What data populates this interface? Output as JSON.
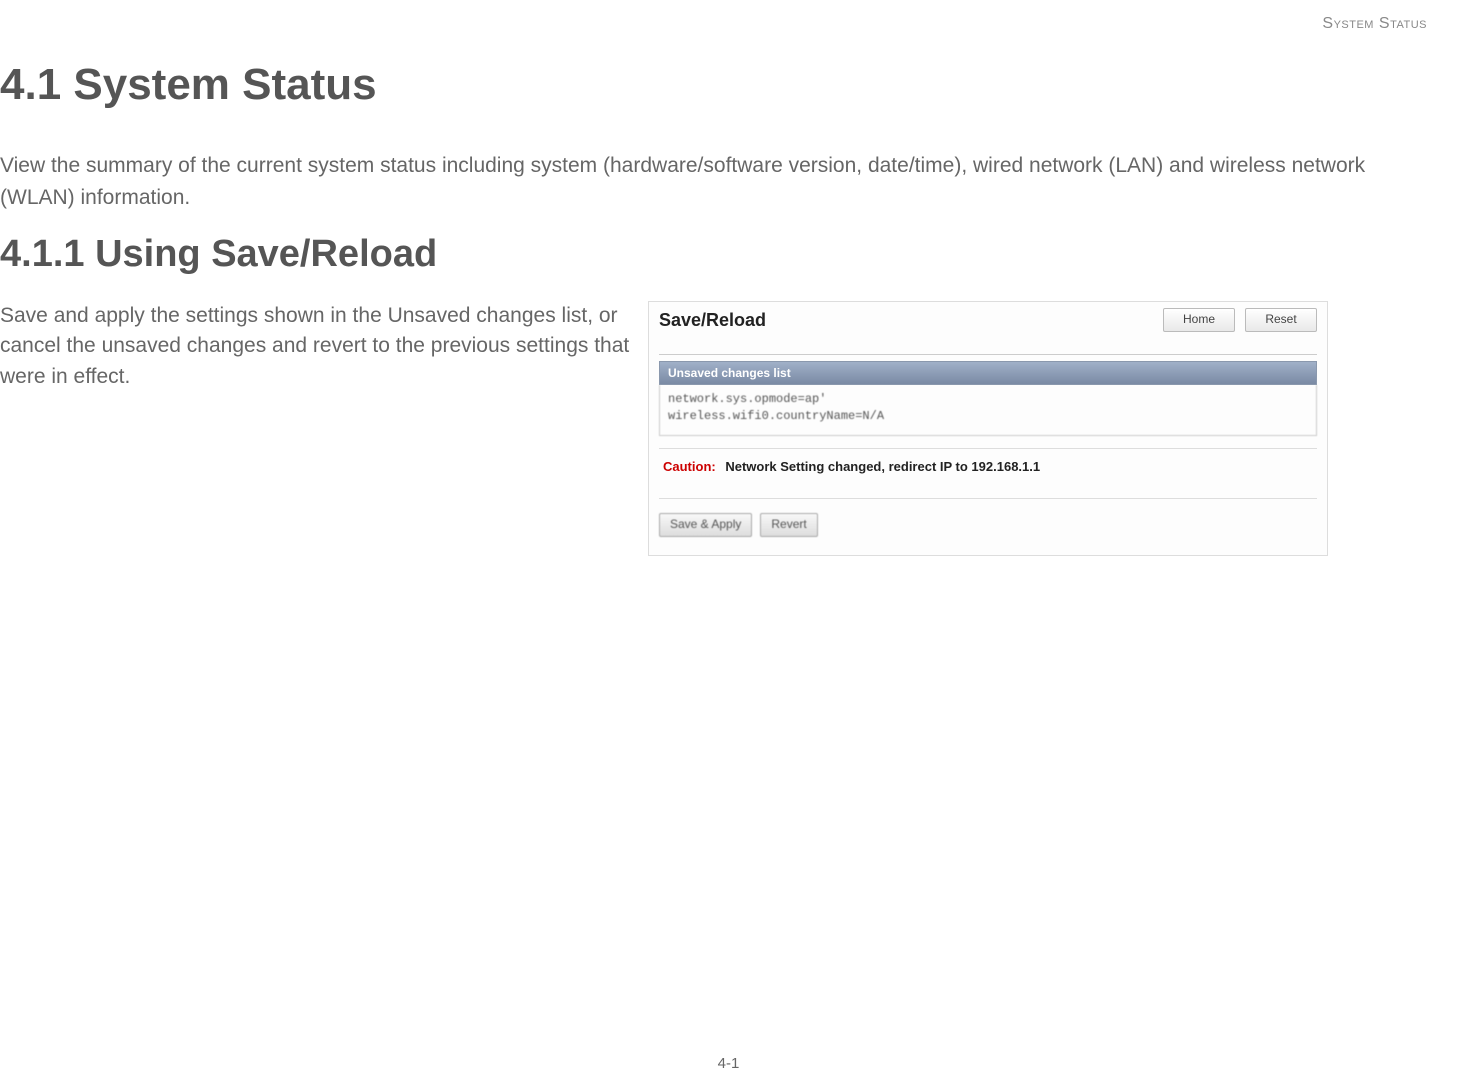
{
  "header": {
    "label": "System Status"
  },
  "section": {
    "heading": "4.1 System Status",
    "intro": "View the summary of the current system status including system (hardware/software version, date/time), wired network (LAN) and wireless network (WLAN) information."
  },
  "subsection": {
    "heading": "4.1.1 Using Save/Reload",
    "body": "Save and apply the settings shown in the Unsaved changes list, or cancel the unsaved changes and revert to the previous settings that were in effect."
  },
  "screenshot": {
    "title": "Save/Reload",
    "top_buttons": {
      "home": "Home",
      "reset": "Reset"
    },
    "panel_header": "Unsaved changes list",
    "panel_body": "network.sys.opmode=ap'\nwireless.wifi0.countryName=N/A",
    "caution_label": "Caution:",
    "caution_text": "Network Setting changed, redirect IP to 192.168.1.1",
    "actions": {
      "save_apply": "Save & Apply",
      "revert": "Revert"
    }
  },
  "footer": {
    "page": "4-1"
  }
}
